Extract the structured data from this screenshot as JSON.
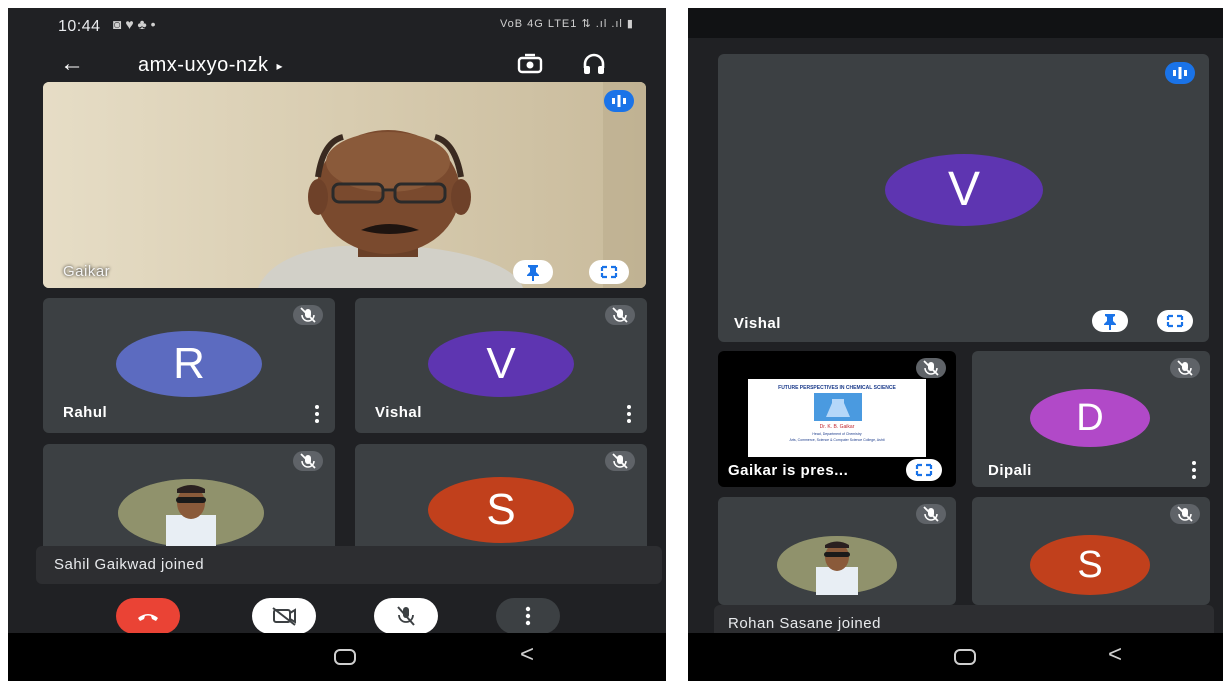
{
  "status": {
    "time": "10:44",
    "notif_icons": "◙ ♥ ♣ •",
    "right": "VoB 4G LTE1 ⇅ .ıl .ıl ▮"
  },
  "meeting": {
    "code": "amx-uxyo-nzk",
    "caret": "▸"
  },
  "phone1": {
    "main_tile": {
      "name": "Gaikar"
    },
    "tiles": [
      {
        "initial": "R",
        "name": "Rahul",
        "color": "#5c6bc0"
      },
      {
        "initial": "V",
        "name": "Vishal",
        "color": "#5e35b1"
      },
      {
        "initial": "S",
        "color": "#c1401c"
      }
    ],
    "toast": "Sahil Gaikwad joined"
  },
  "phone2": {
    "main_tile": {
      "initial": "V",
      "name": "Vishal",
      "color": "#5e35b1"
    },
    "presenting": {
      "label": "Gaikar is pres...",
      "slide_title": "FUTURE PERSPECTIVES IN CHEMICAL SCIENCE",
      "slide_author": "Dr. K. B. Gaikar",
      "slide_line1": "Head, Department of Chemistry",
      "slide_line2": "Arts, Commerce, Science & Computer Science College, Ashti"
    },
    "tiles": [
      {
        "initial": "D",
        "name": "Dipali",
        "color": "#b149c8"
      },
      {
        "initial": "S",
        "color": "#c1401c"
      }
    ],
    "toast": "Rohan Sasane joined"
  },
  "colors": {
    "background": "#202124",
    "tile": "#3c4043",
    "end_call": "#ea4335",
    "accent_blue": "#1a73e8"
  },
  "icons": [
    "back-arrow-icon",
    "switch-camera-icon",
    "headphones-icon",
    "mic-off-icon",
    "pin-icon",
    "fullscreen-icon",
    "speaking-icon",
    "end-call-icon",
    "camera-off-icon",
    "more-options-icon",
    "home-icon",
    "back-icon"
  ]
}
